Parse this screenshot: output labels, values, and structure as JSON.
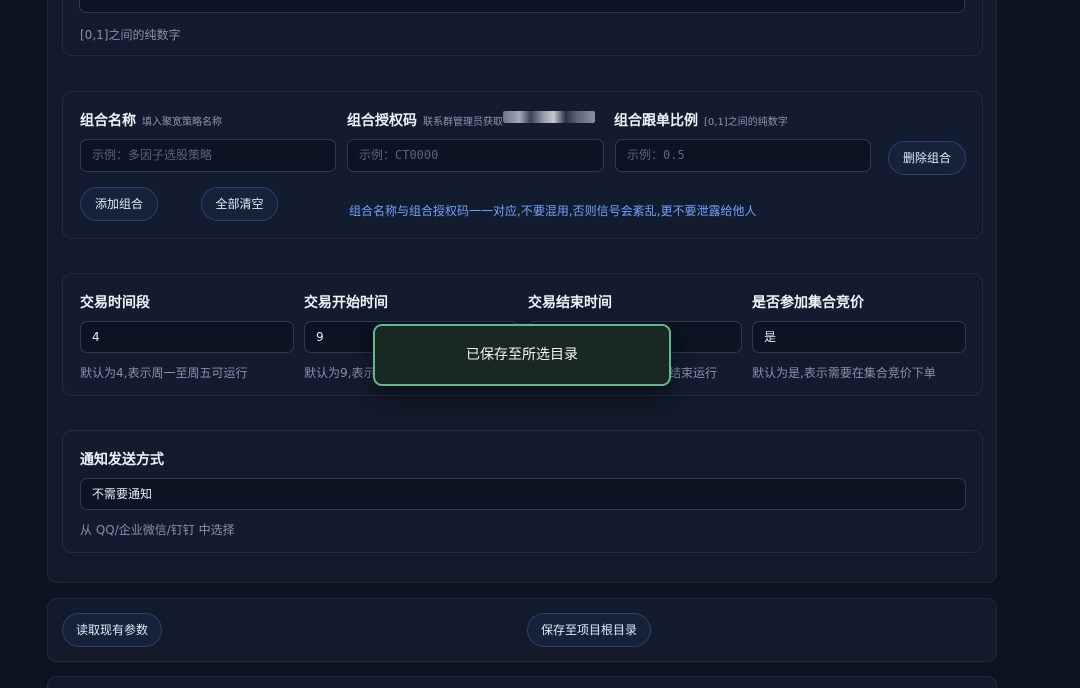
{
  "top_section": {
    "hint": "[0,1]之间的纯数字"
  },
  "combo_section": {
    "name_label": "组合名称",
    "name_sublabel": "填入聚宽策略名称",
    "name_placeholder": "示例：多因子选股策略",
    "auth_label": "组合授权码",
    "auth_sublabel": "联系群管理员获取",
    "auth_placeholder": "示例：CT0000",
    "ratio_label": "组合跟单比例",
    "ratio_sublabel": "[0,1]之间的纯数字",
    "ratio_placeholder": "示例：0.5",
    "delete_button": "删除组合",
    "add_button": "添加组合",
    "clear_button": "全部清空",
    "note": "组合名称与组合授权码一一对应,不要混用,否则信号会紊乱,更不要泄露给他人"
  },
  "trade_section": {
    "period_label": "交易时间段",
    "period_value": "4",
    "period_hint": "默认为4,表示周一至周五可运行",
    "start_label": "交易开始时间",
    "start_value": "9",
    "start_hint": "默认为9,表示",
    "end_label": "交易结束时间",
    "end_value": "",
    "end_hint": "结束运行",
    "auction_label": "是否参加集合竞价",
    "auction_value": "是",
    "auction_hint": "默认为是,表示需要在集合竞价下单"
  },
  "notify_section": {
    "label": "通知发送方式",
    "value": "不需要通知",
    "hint": "从 QQ/企业微信/钉钉 中选择"
  },
  "actions": {
    "read_button": "读取现有参数",
    "save_button": "保存至项目根目录"
  },
  "toast": {
    "message": "已保存至所选目录"
  }
}
